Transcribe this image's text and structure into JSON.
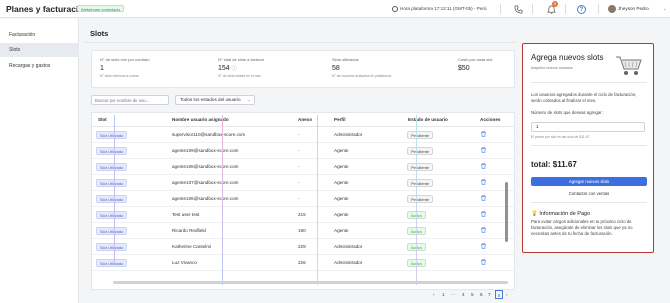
{
  "header": {
    "app_title": "Planes y facturación",
    "phone_badge": "Webphone conectado",
    "platform_time": "Hora plataforma 17:12:11 (GMT-05) - Perú",
    "notifications_count": "5",
    "help_label": "?",
    "user_name": "Jheyson Pedro",
    "user_menu_caret": "⌄"
  },
  "sidebar": {
    "items": [
      {
        "label": "Facturación"
      },
      {
        "label": "Slots"
      },
      {
        "label": "Recargas y gastos"
      }
    ]
  },
  "page": {
    "title": "Slots"
  },
  "stats": [
    {
      "label": "N° de slots mín por contrato",
      "value": "1",
      "sub": "N° slots mínimos a cobrar"
    },
    {
      "label": "N° total de slots a facturar",
      "value": "154",
      "sub": "N° de slots totales en el mes"
    },
    {
      "label": "Slots utilizados",
      "value": "58",
      "sub": "N° de usuarios activados en plataforma"
    },
    {
      "label": "Costo por cada slot",
      "value": "$50",
      "sub": ""
    }
  ],
  "stat_info_icon": "ⓘ",
  "filters": {
    "search_placeholder": "Buscar por nombre de usu...",
    "status_label": "Todos los estados del usuario",
    "status_caret": "⌄"
  },
  "table": {
    "columns": {
      "slot": "Slot",
      "user": "Nombre usuario asignado",
      "annex": "Anexo",
      "profile": "Perfil",
      "status": "Estado de usuario",
      "actions": "Acciones"
    },
    "rows": [
      {
        "slot": "Slot Utilizado",
        "user": "supervisor110@sandbox-score.com",
        "annex": "-",
        "profile": "Administrador",
        "status": "Pendiente",
        "status_type": "pend"
      },
      {
        "slot": "Slot Utilizado",
        "user": "agente109@sandbox-score.com",
        "annex": "-",
        "profile": "Agente",
        "status": "Pendiente",
        "status_type": "pend"
      },
      {
        "slot": "Slot Utilizado",
        "user": "agente108@sandbox-score.com",
        "annex": "-",
        "profile": "Agente",
        "status": "Pendiente",
        "status_type": "pend"
      },
      {
        "slot": "Slot Utilizado",
        "user": "agente107@sandbox-score.com",
        "annex": "-",
        "profile": "Agente",
        "status": "Pendiente",
        "status_type": "pend"
      },
      {
        "slot": "Slot Utilizado",
        "user": "agente106@sandbox-score.com",
        "annex": "-",
        "profile": "Agente",
        "status": "Pendiente",
        "status_type": "pend"
      },
      {
        "slot": "Slot Utilizado",
        "user": "Test user test",
        "annex": "215",
        "profile": "Agente",
        "status": "Activo",
        "status_type": "act"
      },
      {
        "slot": "Slot Utilizado",
        "user": "Ricardo Redfield",
        "annex": "190",
        "profile": "Agente",
        "status": "Activo",
        "status_type": "act"
      },
      {
        "slot": "Slot Utilizado",
        "user": "Katherine Cantelmi",
        "annex": "229",
        "profile": "Administrador",
        "status": "Activo",
        "status_type": "act"
      },
      {
        "slot": "Slot Utilizado",
        "user": "Luz Vivanco",
        "annex": "226",
        "profile": "Administrador",
        "status": "Activo",
        "status_type": "act"
      }
    ]
  },
  "pagination": {
    "prev": "‹",
    "items": [
      "1",
      "···",
      "4",
      "5",
      "6",
      "7",
      "8"
    ],
    "current": "8",
    "next": "›"
  },
  "panel": {
    "title": "Agrega nuevos slots",
    "subtitle": "Adquiere nuevos usuarios",
    "description": "Los usuarios agregados durante el ciclo de facturación, serán cobrados al finalizar el mes.",
    "qty_label": "Número de slots que deseas agregar:",
    "qty_value": "1",
    "qty_hint": "El precio por slot es tan solo de $11.67",
    "total": "total: $11.67",
    "primary_button": "Agregar nuevos slots",
    "secondary_button": "Contactar con ventas",
    "info_title": "Información de Pago",
    "info_text": "Para evitar cargos adicionales en tu próximo ciclo de facturación, asegúrate de eliminar los slots que ya no necesitas antes de tu fecha de facturación."
  },
  "colors": {
    "primary": "#3d6fe0",
    "panel_border": "#b23a32",
    "status_active": "#3f9f4c",
    "slot_tag": "#4b5fae"
  }
}
